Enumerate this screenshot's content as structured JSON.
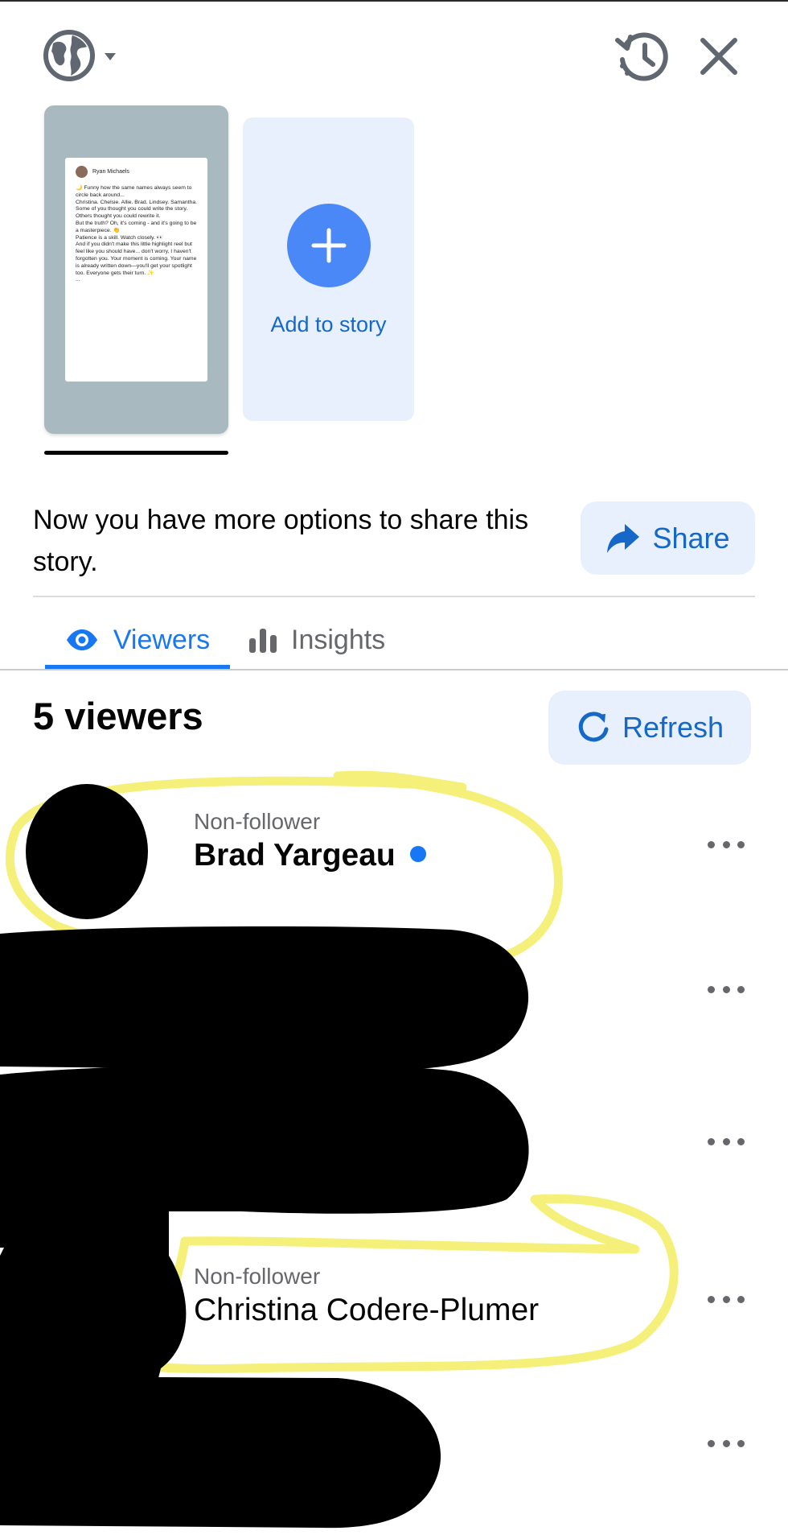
{
  "header": {
    "globe_icon": "globe-icon",
    "history_icon": "history-icon",
    "close_icon": "close-icon"
  },
  "story": {
    "card": {
      "author": "Ryan Michaels",
      "lines": [
        "🌙 Funny how the same names always seem to circle back around...",
        "",
        "Christina. Chelsie. Allie. Brad. Lindsey. Samantha.",
        "",
        "Some of you thought you could write the story.",
        "Others thought you could rewrite it.",
        "But the truth? Oh, it's coming - and it's going to be a masterpiece. 👏",
        "",
        "Patience is a skill. Watch closely. 👀",
        "",
        "And if you didn't make this little highlight reel but feel like you should have... don't worry, I haven't forgotten you. Your moment is coming. Your name is already written down—you'll get your spotlight too. Everyone gets their turn. ✨",
        "..."
      ]
    },
    "add_label": "Add to story"
  },
  "share": {
    "text": "Now you have more options to share this story.",
    "button_label": "Share"
  },
  "tabs": [
    {
      "label": "Viewers",
      "active": true
    },
    {
      "label": "Insights",
      "active": false
    }
  ],
  "viewers": {
    "count_label": "5 viewers",
    "refresh_label": "Refresh",
    "items": [
      {
        "subtitle": "Non-follower",
        "name": "Brad Yargeau",
        "unread": true
      },
      {
        "subtitle": "",
        "name": "",
        "unread": false
      },
      {
        "subtitle": "",
        "name": "",
        "unread": false
      },
      {
        "subtitle": "Non-follower",
        "name": "Christina Codere-Plumer",
        "unread": false
      },
      {
        "subtitle": "",
        "name": "",
        "unread": false
      }
    ]
  },
  "colors": {
    "accent": "#1877f2",
    "accent_text": "#1567c8",
    "button_bg": "#e7f0fc",
    "secondary_text": "#65676b",
    "highlighter": "#f5f07a",
    "redaction": "#000000"
  }
}
